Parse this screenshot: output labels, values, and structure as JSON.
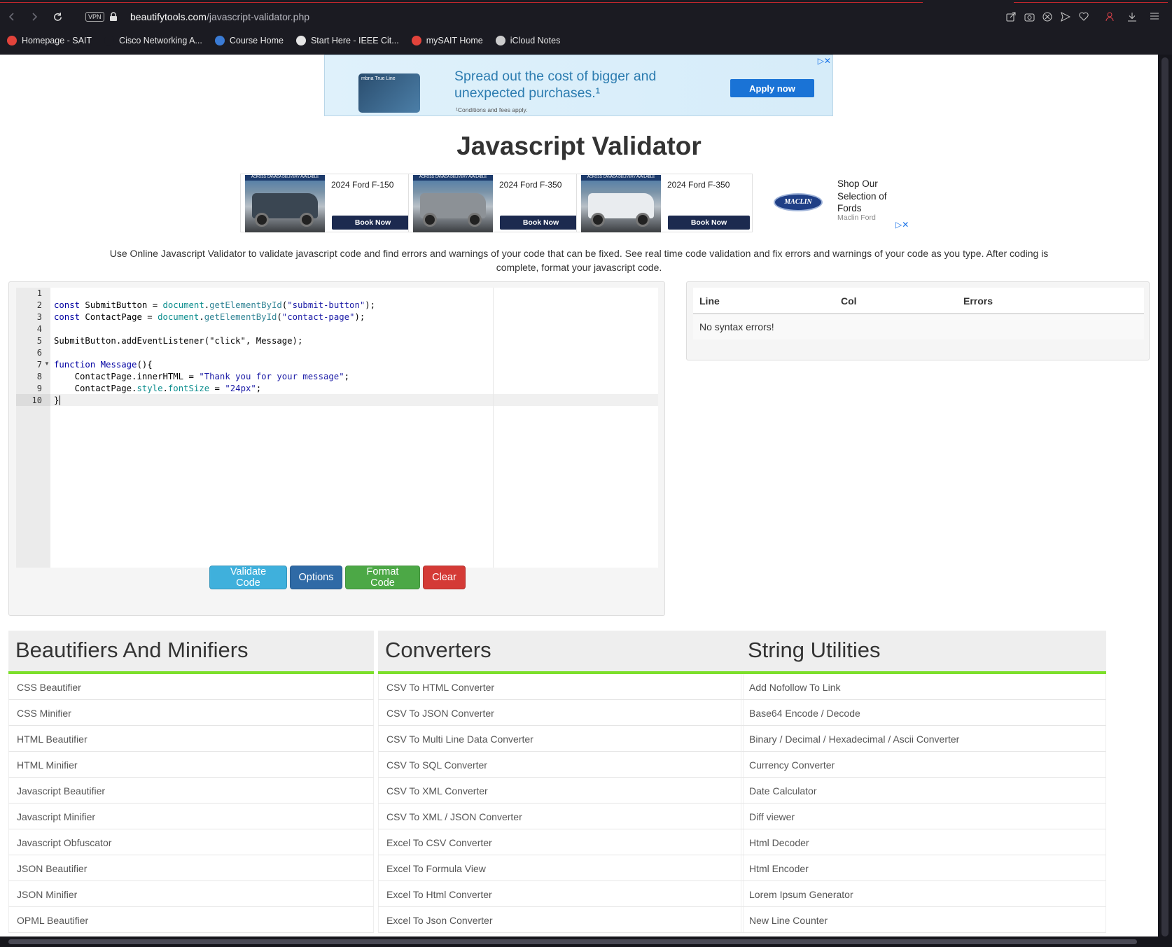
{
  "browser": {
    "url_domain": "beautifytools.com",
    "url_path": "/javascript-validator.php",
    "vpn_label": "VPN",
    "bookmarks": [
      {
        "label": "Homepage - SAIT",
        "color": "#e2433b"
      },
      {
        "label": "Cisco Networking A...",
        "color": "#1b1b22"
      },
      {
        "label": "Course Home",
        "color": "#3a7bd5"
      },
      {
        "label": "Start Here - IEEE Cit...",
        "color": "#e5e5e5"
      },
      {
        "label": "mySAIT Home",
        "color": "#e2433b"
      },
      {
        "label": "iCloud Notes",
        "color": "#cccccc"
      }
    ]
  },
  "top_ad": {
    "card_brand": "mbna",
    "card_name": "True Line",
    "headline": "Spread out the cost of bigger and unexpected purchases.¹",
    "note": "¹Conditions and fees apply.",
    "cta": "Apply now"
  },
  "page_title": "Javascript Validator",
  "ford_ads": {
    "items": [
      {
        "model": "2024 Ford F-150",
        "cta": "Book Now",
        "paint": "#3a4652"
      },
      {
        "model": "2024 Ford F-350",
        "cta": "Book Now",
        "paint": "#8c9196"
      },
      {
        "model": "2024 Ford F-350",
        "cta": "Book Now",
        "paint": "#e9ecef"
      }
    ],
    "band_text": "ACROSS CANADA DELIVERY AVAILABLE",
    "dealer_logo": "MACLIN",
    "shop_text": "Shop Our Selection of Fords",
    "dealer": "Maclin Ford"
  },
  "description": "Use Online Javascript Validator to validate javascript code and find errors and warnings of your code that can be fixed. See real time code validation and fix errors and warnings of your code as you type. After coding is complete, format your javascript code.",
  "editor": {
    "line_numbers": [
      "1",
      "2",
      "3",
      "4",
      "5",
      "6",
      "7",
      "8",
      "9",
      "10"
    ],
    "code": {
      "l2": [
        "const",
        " SubmitButton ",
        "=",
        " ",
        "document",
        ".",
        "getElementById",
        "(",
        "\"submit-button\"",
        ");"
      ],
      "l3": [
        "const",
        " ContactPage ",
        "=",
        " ",
        "document",
        ".",
        "getElementById",
        "(",
        "\"contact-page\"",
        ");"
      ],
      "l5": "SubmitButton.addEventListener(\"click\", Message);",
      "l7": [
        "function",
        " ",
        "Message",
        "(){"
      ],
      "l8": [
        "    ContactPage.innerHTML ",
        "=",
        " ",
        "\"Thank you for your message\"",
        ";"
      ],
      "l9": [
        "    ContactPage.",
        "style",
        ".",
        "fontSize",
        " ",
        "=",
        " ",
        "\"24px\"",
        ";"
      ],
      "l10": "}"
    }
  },
  "buttons": {
    "validate": "Validate Code",
    "options": "Options",
    "format": "Format Code",
    "clear": "Clear"
  },
  "results": {
    "col_line": "Line",
    "col_col": "Col",
    "col_errors": "Errors",
    "message": "No syntax errors!"
  },
  "categories": [
    {
      "title": "Beautifiers And Minifiers",
      "items": [
        "CSS Beautifier",
        "CSS Minifier",
        "HTML Beautifier",
        "HTML Minifier",
        "Javascript Beautifier",
        "Javascript Minifier",
        "Javascript Obfuscator",
        "JSON Beautifier",
        "JSON Minifier",
        "OPML Beautifier"
      ]
    },
    {
      "title": "Converters",
      "items": [
        "CSV To HTML Converter",
        "CSV To JSON Converter",
        "CSV To Multi Line Data Converter",
        "CSV To SQL Converter",
        "CSV To XML Converter",
        "CSV To XML / JSON Converter",
        "Excel To CSV Converter",
        "Excel To Formula View",
        "Excel To Html Converter",
        "Excel To Json Converter"
      ]
    },
    {
      "title": "String Utilities",
      "items": [
        "Add Nofollow To Link",
        "Base64 Encode / Decode",
        "Binary / Decimal / Hexadecimal / Ascii Converter",
        "Currency Converter",
        "Date Calculator",
        "Diff viewer",
        "Html Decoder",
        "Html Encoder",
        "Lorem Ipsum Generator",
        "New Line Counter"
      ]
    }
  ],
  "colors": {
    "accent_green": "#7cdf2b",
    "validate": "#3fb0dc",
    "options": "#2f6aa6",
    "format": "#4ca846",
    "clear": "#d43a36"
  }
}
